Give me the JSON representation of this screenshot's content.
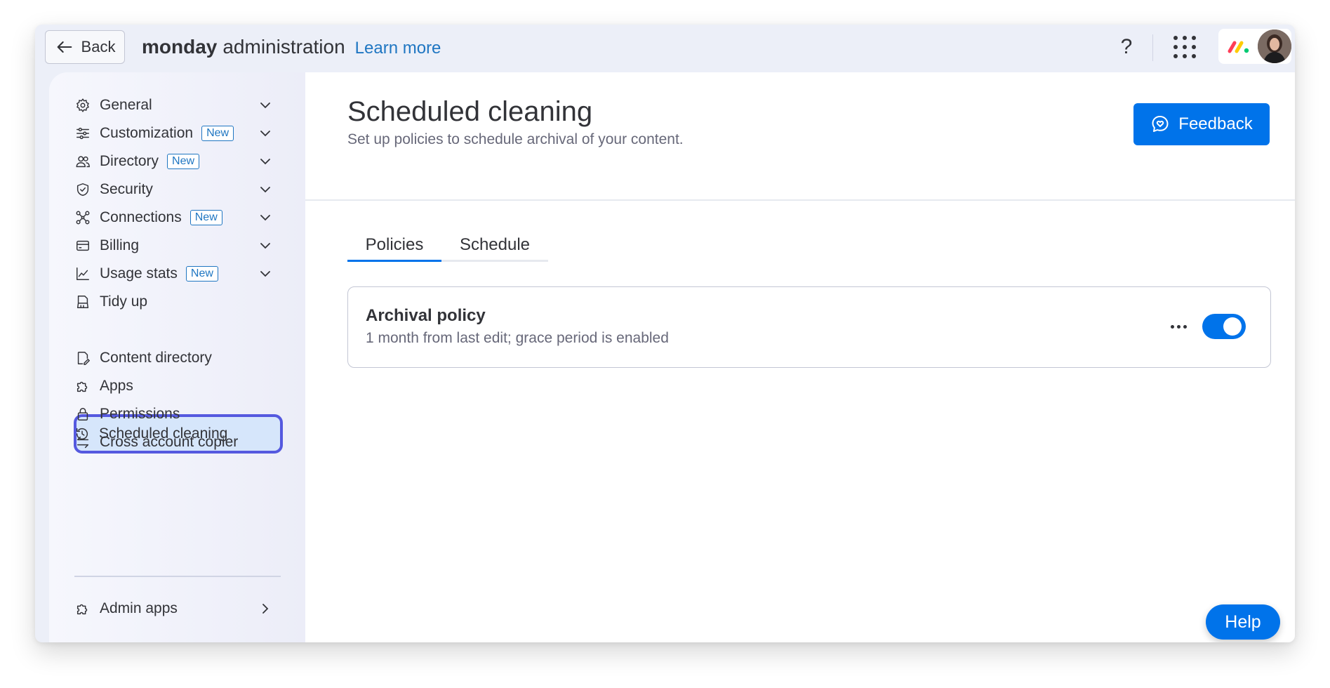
{
  "topbar": {
    "back_label": "Back",
    "brand_bold": "monday",
    "brand_rest": "administration",
    "learn_more": "Learn more",
    "help_symbol": "?"
  },
  "sidebar": {
    "items": [
      {
        "label": "General",
        "icon": "gear-icon",
        "badge": "",
        "chevron": "down"
      },
      {
        "label": "Customization",
        "icon": "sliders-icon",
        "badge": "New",
        "chevron": "down"
      },
      {
        "label": "Directory",
        "icon": "users-icon",
        "badge": "New",
        "chevron": "down"
      },
      {
        "label": "Security",
        "icon": "shield-icon",
        "badge": "",
        "chevron": "down"
      },
      {
        "label": "Connections",
        "icon": "connections-icon",
        "badge": "New",
        "chevron": "down"
      },
      {
        "label": "Billing",
        "icon": "billing-icon",
        "badge": "",
        "chevron": "down"
      },
      {
        "label": "Usage stats",
        "icon": "chart-icon",
        "badge": "New",
        "chevron": "down"
      },
      {
        "label": "Tidy up",
        "icon": "broom-icon",
        "badge": "",
        "chevron": ""
      },
      {
        "label": "Scheduled cleaning",
        "icon": "history-icon",
        "badge": "",
        "chevron": "",
        "active": true
      },
      {
        "label": "Content directory",
        "icon": "content-icon",
        "badge": "",
        "chevron": ""
      },
      {
        "label": "Apps",
        "icon": "puzzle-icon",
        "badge": "",
        "chevron": ""
      },
      {
        "label": "Permissions",
        "icon": "lock-icon",
        "badge": "",
        "chevron": ""
      },
      {
        "label": "Cross account copier",
        "icon": "transfer-icon",
        "badge": "",
        "chevron": ""
      }
    ],
    "admin_apps": {
      "label": "Admin apps",
      "icon": "puzzle-icon",
      "chevron": "right"
    }
  },
  "main": {
    "title": "Scheduled cleaning",
    "subtitle": "Set up policies to schedule archival of your content.",
    "feedback_label": "Feedback",
    "tabs": [
      {
        "label": "Policies",
        "selected": true
      },
      {
        "label": "Schedule",
        "selected": false
      }
    ],
    "policy": {
      "title": "Archival policy",
      "description": "1 month from last edit; grace period is enabled",
      "enabled": true
    }
  },
  "help_button": "Help",
  "colors": {
    "primary": "#0073ea",
    "link": "#1f76c2",
    "active_outline": "#5559df",
    "active_fill": "#d6e6fb",
    "text": "#323338",
    "muted": "#676879"
  }
}
